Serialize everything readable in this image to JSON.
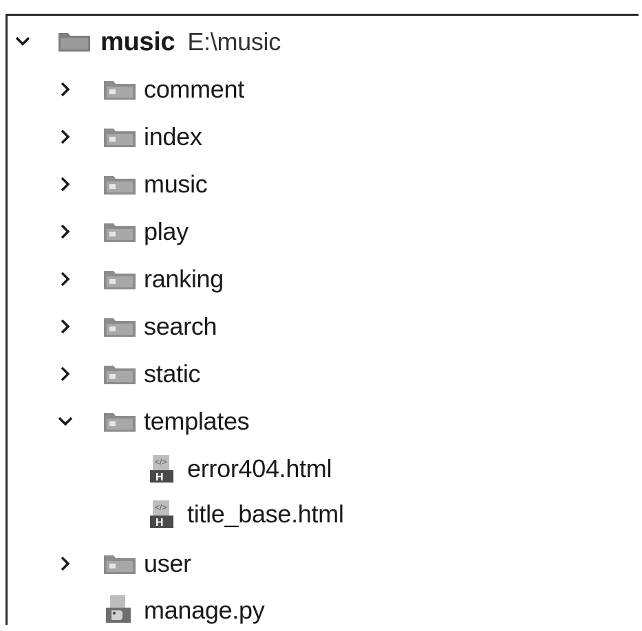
{
  "project": {
    "name": "music",
    "path": "E:\\music",
    "expanded": true
  },
  "items": [
    {
      "label": "comment",
      "type": "folder",
      "expanded": false
    },
    {
      "label": "index",
      "type": "folder",
      "expanded": false
    },
    {
      "label": "music",
      "type": "folder",
      "expanded": false
    },
    {
      "label": "play",
      "type": "folder",
      "expanded": false
    },
    {
      "label": "ranking",
      "type": "folder",
      "expanded": false
    },
    {
      "label": "search",
      "type": "folder",
      "expanded": false
    },
    {
      "label": "static",
      "type": "folder",
      "expanded": false
    },
    {
      "label": "templates",
      "type": "folder",
      "expanded": true
    },
    {
      "label": "error404.html",
      "type": "html-file"
    },
    {
      "label": "title_base.html",
      "type": "html-file"
    },
    {
      "label": "user",
      "type": "folder",
      "expanded": false
    },
    {
      "label": "manage.py",
      "type": "python-file"
    }
  ],
  "colors": {
    "icon_gray": "#8c8c8c",
    "text": "#1a1a1a",
    "border": "#2a2a2a"
  }
}
